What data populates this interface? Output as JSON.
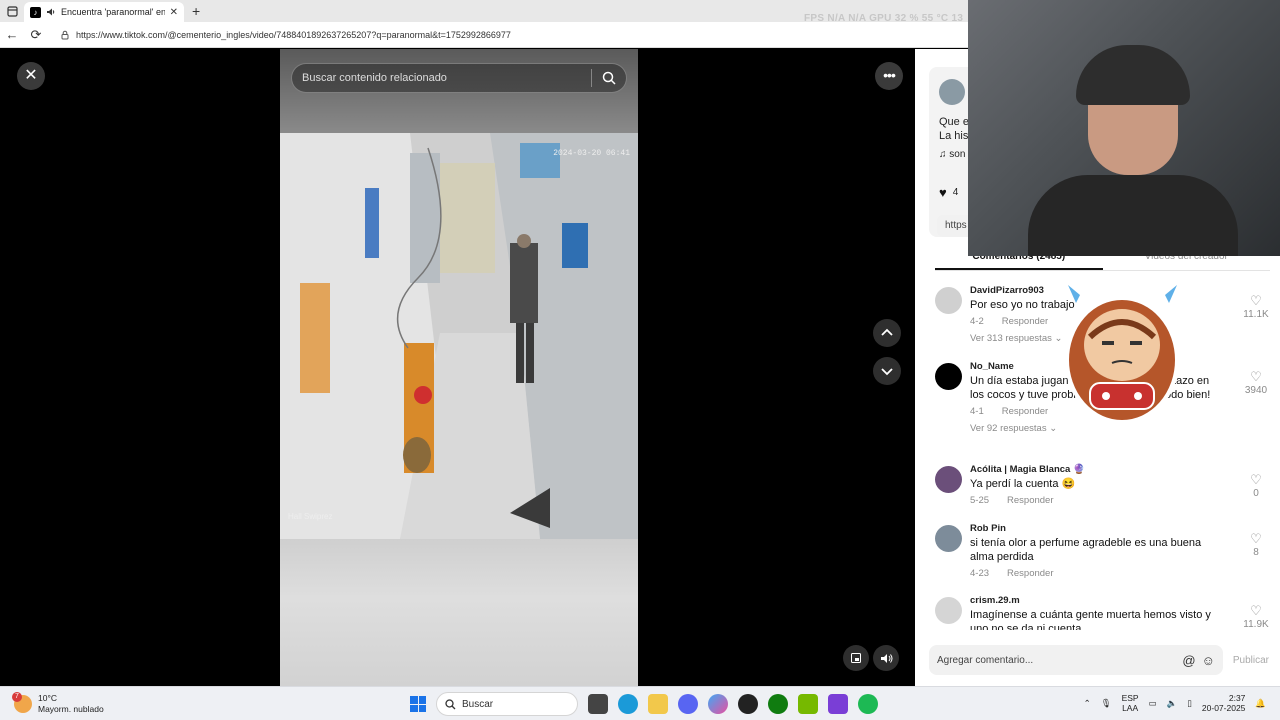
{
  "browser": {
    "tab_title": "Encuentra 'paranormal' en TikTok",
    "fav_glyph": "♪",
    "url": "https://www.tiktok.com/@cementerio_ingles/video/7488401892637265207?q=paranormal&t=1752992866977",
    "overlay_fps": "FPS  N/A  N/A       GPU  32 %  55 °C  13"
  },
  "viewer": {
    "search_placeholder": "Buscar contenido relacionado",
    "camera_timestamp": "2024-03-20 06:41",
    "camera_label": "Hall Swiprez"
  },
  "panel": {
    "desc_line1": "Que e",
    "desc_line2": "La his",
    "music": "♫ son",
    "likes": "4",
    "link": "https",
    "tabs": [
      {
        "label": "Comentarios (2485)"
      },
      {
        "label": "Videos del creador"
      }
    ],
    "comments": [
      {
        "user": "DavidPizarro903",
        "text": "Por eso yo no trabajo",
        "date": "4-2",
        "reply": "Responder",
        "replies": "Ver 313 respuestas ⌄",
        "likes": "11.1K",
        "avatar": "#d0d0d0"
      },
      {
        "user": "No_Name",
        "text": "Un día estaba jugando y me llegó un pelotazo en los cocos y tuve problemas pero ahora todo bien!",
        "date": "4-1",
        "reply": "Responder",
        "replies": "Ver 92 respuestas ⌄",
        "likes": "3940",
        "avatar": "#000000"
      },
      {
        "user": "Acólita | Magia Blanca 🔮",
        "text": "Ya perdí la cuenta 😆",
        "date": "5-25",
        "reply": "Responder",
        "replies": "",
        "likes": "0",
        "avatar": "#6b4f7a"
      },
      {
        "user": "Rob Pin",
        "text": "si tenía olor a perfume agradeble es una buena alma perdida",
        "date": "4-23",
        "reply": "Responder",
        "replies": "",
        "likes": "8",
        "avatar": "#7d8c9a"
      },
      {
        "user": "crism.29.m",
        "text": "Imagínense a cuánta gente muerta hemos visto y uno no se da ni cuenta",
        "date": "",
        "reply": "",
        "replies": "",
        "likes": "11.9K",
        "avatar": "#d5d5d5"
      }
    ],
    "comment_placeholder": "Agregar comentario...",
    "publish": "Publicar"
  },
  "taskbar": {
    "temp": "10°C",
    "weather": "Mayorm. nublado",
    "weather_badge": "7",
    "search": "Buscar",
    "lang1": "ESP",
    "lang2": "LAA",
    "time": "2:37",
    "date": "20-07-2025"
  },
  "colors": {
    "accent": "#fe2c55",
    "panel_bg": "#ffffff",
    "stage_bg": "#000000"
  }
}
